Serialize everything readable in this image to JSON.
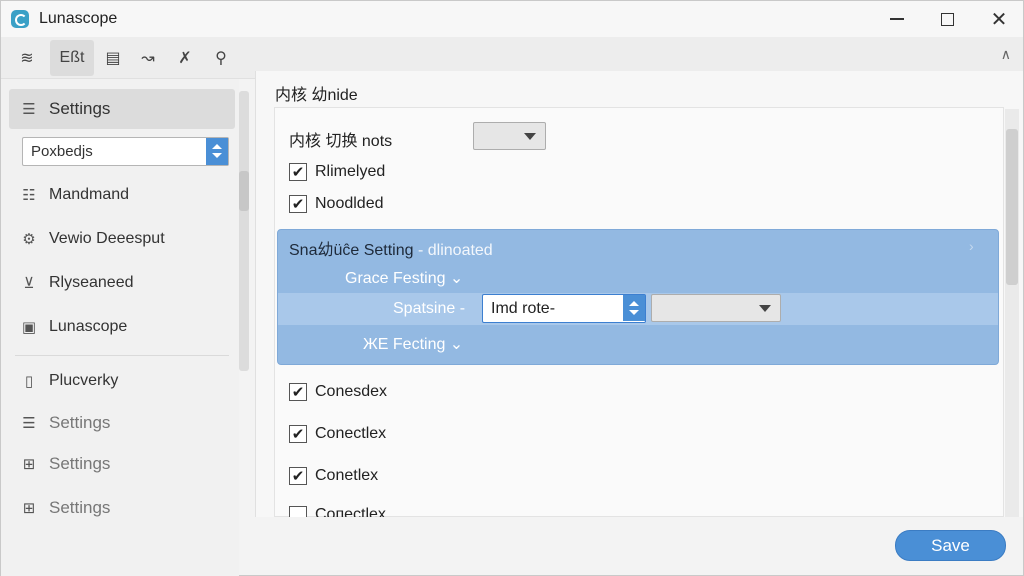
{
  "window": {
    "title": "Lunascope",
    "minimize_label": "",
    "maximize_label": "",
    "close_label": "✕"
  },
  "toolbar": {
    "items": [
      {
        "name": "layers",
        "label": "",
        "icon": "layers-icon",
        "glyph": "≋"
      },
      {
        "name": "edit",
        "label": "Eßt",
        "icon": "",
        "glyph": ""
      },
      {
        "name": "device",
        "label": "",
        "icon": "device-icon",
        "glyph": "▤"
      },
      {
        "name": "graph",
        "label": "",
        "icon": "graph-icon",
        "glyph": "↝"
      },
      {
        "name": "run",
        "label": "",
        "icon": "run-icon",
        "glyph": "✗"
      },
      {
        "name": "walk",
        "label": "",
        "icon": "walk-icon",
        "glyph": "⚲"
      }
    ],
    "collapse_glyph": "∧"
  },
  "sidebar": {
    "header": {
      "label": "Settings",
      "icon": "list-settings-icon",
      "glyph": "☰"
    },
    "select": {
      "value": "Poxbedjs"
    },
    "items": [
      {
        "label": "Mandmand",
        "icon": "grid-list-icon",
        "glyph": "☷"
      },
      {
        "label": "Vewio Deeesput",
        "icon": "gear-icon",
        "glyph": "⚙"
      },
      {
        "label": "Rlyseaneed",
        "icon": "filter-icon",
        "glyph": "⊻"
      },
      {
        "label": "Lunascope",
        "icon": "image-icon",
        "glyph": "▣"
      },
      {
        "label": "Plucverky",
        "icon": "folder-icon",
        "glyph": "▯"
      },
      {
        "label": "Settings",
        "icon": "bars-icon",
        "glyph": "☰"
      },
      {
        "label": "Settings",
        "icon": "grid-icon",
        "glyph": "⊞"
      },
      {
        "label": "Settings",
        "icon": "grid-icon",
        "glyph": "⊞"
      }
    ]
  },
  "main": {
    "section_title": "内核 幼nide",
    "row1_label": "内核 切换 nots",
    "checkboxes_top": [
      {
        "label": "Rlimelyed",
        "checked": "✔"
      },
      {
        "label": "Noodlded",
        "checked": "✔"
      }
    ],
    "group": {
      "title_dark": "Sna幼üĉe Setting",
      "title_light": "- dlinoated",
      "chevron": "›",
      "subrow1": "Grace Festing ⌄",
      "subrow2": "Spatsine -",
      "select_value": "Imd rote-",
      "subrow3": "ЖE Fecting ⌄"
    },
    "checkboxes_bottom": [
      {
        "label": "Conesdex",
        "checked": "✔"
      },
      {
        "label": "Conectlex",
        "checked": "✔"
      },
      {
        "label": "Conetlex",
        "checked": "✔"
      },
      {
        "label": "Сопесtlex",
        "checked": ""
      }
    ]
  },
  "footer": {
    "save_label": "Save"
  },
  "colors": {
    "accent": "#4a8fd6",
    "group_bg": "#93b9e2"
  }
}
